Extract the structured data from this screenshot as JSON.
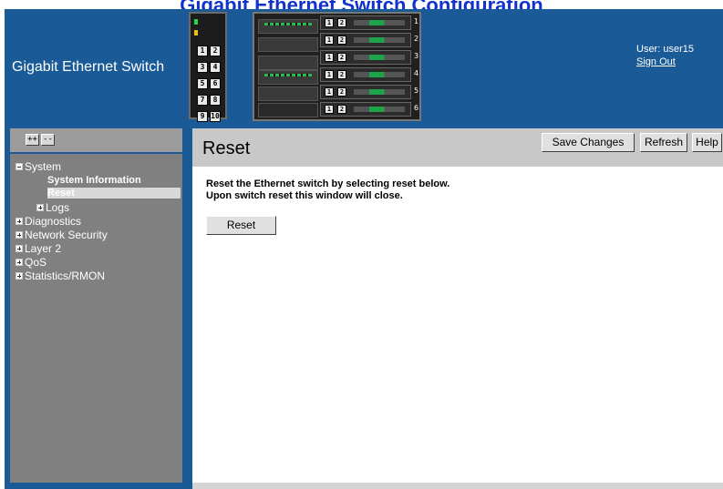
{
  "page_heading": "Gigabit Ethernet Switch Configuration",
  "header": {
    "app_title": "Gigabit Ethernet Switch",
    "user_label": "User: user15",
    "sign_out": "Sign Out",
    "port_module": {
      "ports": [
        "1",
        "2",
        "3",
        "4",
        "5",
        "6",
        "7",
        "8",
        "9",
        "10"
      ]
    },
    "chassis": {
      "slots": [
        "1",
        "2",
        "3",
        "4",
        "5",
        "6"
      ],
      "blade_ports": [
        "1",
        "2"
      ]
    }
  },
  "tree": {
    "expand_all": "++",
    "collapse_all": "--",
    "items": [
      {
        "label": "System",
        "expanded": true
      },
      {
        "label": "Logs"
      },
      {
        "label": "Diagnostics"
      },
      {
        "label": "Network Security"
      },
      {
        "label": "Layer 2"
      },
      {
        "label": "QoS"
      },
      {
        "label": "Statistics/RMON"
      }
    ],
    "system_children": [
      "System Information",
      "Reset"
    ]
  },
  "main": {
    "title": "Reset",
    "buttons": {
      "save": "Save Changes",
      "refresh": "Refresh",
      "help": "Help"
    },
    "desc_line1": "Reset the Ethernet switch by selecting reset below.",
    "desc_line2": "Upon switch reset this window will close.",
    "reset_button": "Reset"
  },
  "colors": {
    "frame_blue": "#1a5a96",
    "tree_gray": "#808080",
    "title_bar_gray": "#c8c8c8",
    "heading_blue": "#1133cc"
  }
}
